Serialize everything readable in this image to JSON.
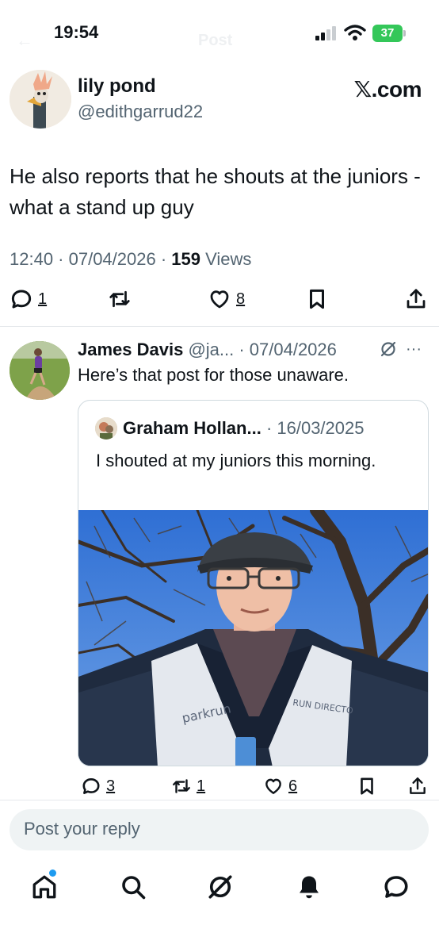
{
  "status_bar": {
    "time": "19:54",
    "battery": "37",
    "ghost_back": "←",
    "ghost_title": "Post"
  },
  "post": {
    "display_name": "lily pond",
    "handle": "@edithgarrud22",
    "brand": "𝕏.com",
    "text": "He also reports that he shouts at the juniors - what a stand up guy",
    "timestamp": "12:40 · 07/04/2026 · ",
    "views_count": "159",
    "views_label": " Views",
    "replies": "1",
    "likes": "8"
  },
  "reply": {
    "display_name": "James Davis",
    "meta": " @ja... · 07/04/2026",
    "more": "···",
    "text": "Here’s that post for those unaware.",
    "quote": {
      "display_name": "Graham Hollan...",
      "date": " · 16/03/2025",
      "text": "I shouted at my juniors this morning.",
      "vest_text_left": "parkrun",
      "vest_text_right": "RUN DIRECTO"
    },
    "replies": "3",
    "reposts": "1",
    "likes": "6"
  },
  "compose": {
    "placeholder": "Post your reply"
  },
  "colors": {
    "text": "#0f1419",
    "secondary": "#536471",
    "accent": "#1d9bf0",
    "battery": "#34c759"
  },
  "tabbar": [
    "home-icon",
    "search-icon",
    "grok-icon",
    "notifications-icon",
    "messages-icon"
  ]
}
